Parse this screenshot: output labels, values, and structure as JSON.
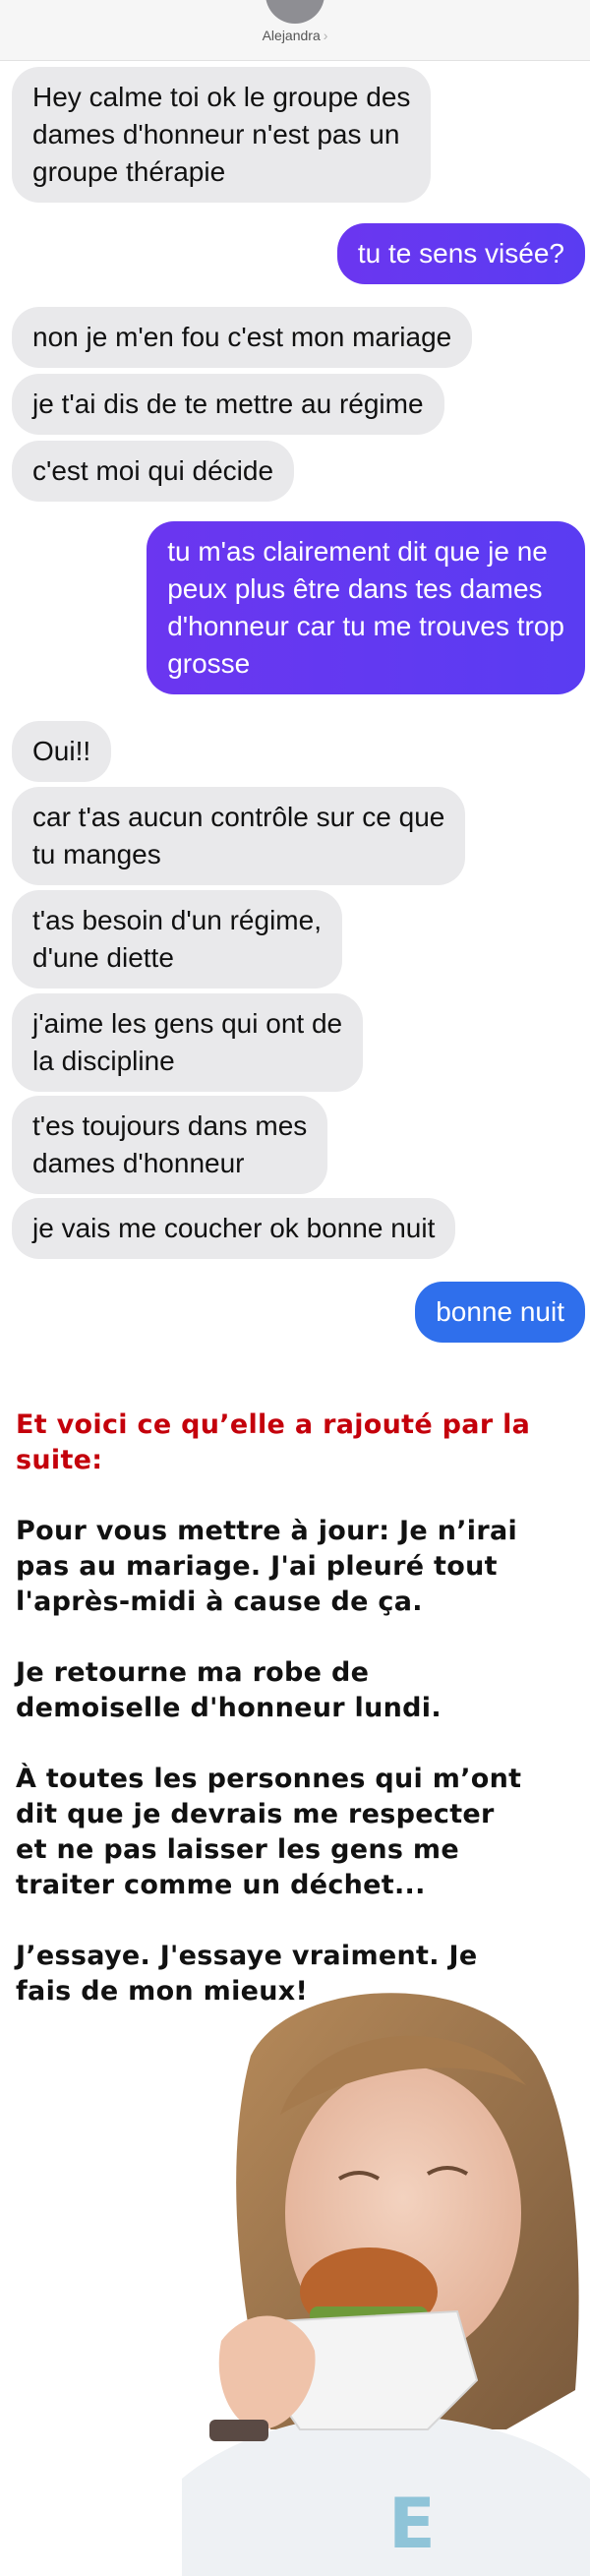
{
  "header": {
    "contact_name": "Alejandra",
    "chevron": "›"
  },
  "messages": [
    {
      "from": "them",
      "lines": [
        "Hey calme toi ok le groupe des",
        "dames d'honneur n'est pas un",
        "groupe thérapie"
      ]
    },
    {
      "from": "me",
      "lines": [
        "tu te sens visée?"
      ]
    },
    {
      "from": "them",
      "lines": [
        "non je m'en fou c'est mon mariage"
      ]
    },
    {
      "from": "them",
      "lines": [
        "je t'ai dis de te mettre au régime"
      ]
    },
    {
      "from": "them",
      "lines": [
        "c'est moi qui décide"
      ]
    },
    {
      "from": "me",
      "lines": [
        "tu m'as clairement dit que je ne",
        "peux plus être dans tes dames",
        "d'honneur car tu me trouves trop",
        "grosse"
      ]
    },
    {
      "from": "them",
      "lines": [
        "Oui!!"
      ]
    },
    {
      "from": "them",
      "lines": [
        "car t'as aucun contrôle sur ce que",
        "tu manges"
      ]
    },
    {
      "from": "them",
      "lines": [
        "t'as besoin d'un régime,",
        "d'une diette"
      ]
    },
    {
      "from": "them",
      "lines": [
        "j'aime les gens qui ont de",
        "la discipline"
      ]
    },
    {
      "from": "them",
      "lines": [
        "t'es toujours dans mes",
        "dames d'honneur"
      ]
    },
    {
      "from": "them",
      "lines": [
        "je vais me coucher ok bonne nuit"
      ]
    },
    {
      "from": "me",
      "lines": [
        "bonne nuit"
      ]
    }
  ],
  "story": {
    "heading": [
      "Et voici ce qu’elle a rajouté par la",
      "suite:"
    ],
    "paragraphs": [
      [
        "Pour vous mettre à jour: Je n’irai",
        "pas au mariage. J'ai pleuré tout",
        "l'après-midi à cause de ça."
      ],
      [
        "Je retourne ma robe de",
        "demoiselle d'honneur lundi."
      ],
      [
        "À toutes les personnes qui m’ont",
        "dit que je devrais me respecter",
        "et ne pas laisser les gens me",
        "traiter comme un déchet..."
      ],
      [
        "J’essaye. J'essaye vraiment. Je",
        "fais de mon mieux!"
      ]
    ]
  },
  "colors": {
    "incoming_bubble": "#e9e9eb",
    "outgoing_purple": "#5f39f1",
    "outgoing_blue": "#2f6fec",
    "heading_red": "#c4000b"
  }
}
